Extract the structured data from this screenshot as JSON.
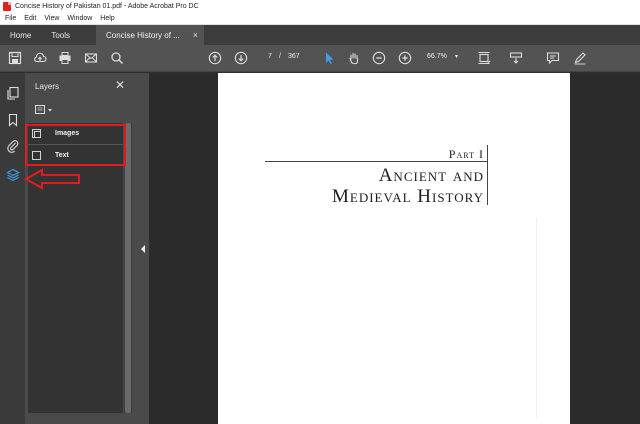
{
  "window": {
    "title": "Concise History of Pakistan 01.pdf - Adobe Acrobat Pro DC"
  },
  "menu": [
    "File",
    "Edit",
    "View",
    "Window",
    "Help"
  ],
  "tabs": {
    "home": "Home",
    "tools": "Tools",
    "document": "Concise History of ...",
    "close_glyph": "×"
  },
  "toolbar": {
    "current_page": "7",
    "separator": "/",
    "total_pages": "367",
    "zoom": "66.7%",
    "zoom_caret": "▾",
    "icons": [
      "save-icon",
      "cloud-upload-icon",
      "print-icon",
      "mail-icon",
      "search-icon",
      "page-up-icon",
      "page-down-icon",
      "select-cursor-icon",
      "hand-icon",
      "zoom-out-icon",
      "zoom-in-icon",
      "page-fit-icon",
      "scroll-mode-icon",
      "comment-icon",
      "pen-icon"
    ]
  },
  "panel": {
    "title": "Layers",
    "close_glyph": "✕",
    "layers": [
      {
        "label": "Images",
        "checked": true
      },
      {
        "label": "Text",
        "checked": false
      }
    ]
  },
  "page": {
    "part_label": "Part I",
    "title_line_1": "Ancient and",
    "title_line_2": "Medieval History"
  },
  "colors": {
    "annotation": "#e21b23",
    "active_rail_icon": "#3d9ee6"
  }
}
